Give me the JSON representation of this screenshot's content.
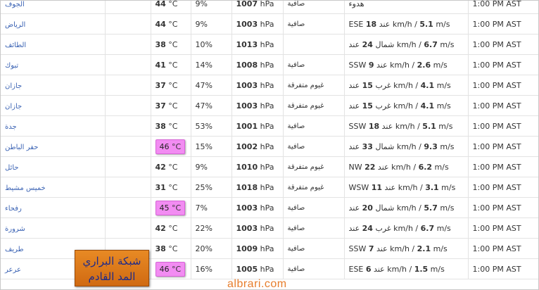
{
  "rows": [
    {
      "city": "الجوف",
      "temp": "44",
      "humidity": "9%",
      "pressure": "1007",
      "condition": "صافية",
      "wind_dir": "",
      "wind_kmh": "",
      "wind_ms": "",
      "wind_text": "هدوء",
      "time": "1:00 PM AST",
      "hot": false
    },
    {
      "city": "الرياض",
      "temp": "44",
      "humidity": "9%",
      "pressure": "1003",
      "condition": "صافية",
      "wind_dir": "ESE",
      "wind_kmh": "18",
      "wind_ms": "5.1",
      "wind_text": "",
      "time": "1:00 PM AST",
      "hot": false
    },
    {
      "city": "الطائف",
      "temp": "38",
      "humidity": "10%",
      "pressure": "1013",
      "condition": "",
      "wind_dir": "شمال",
      "wind_kmh": "24",
      "wind_ms": "6.7",
      "wind_text": "",
      "time": "1:00 PM AST",
      "hot": false
    },
    {
      "city": "تبوك",
      "temp": "41",
      "humidity": "14%",
      "pressure": "1008",
      "condition": "صافية",
      "wind_dir": "SSW",
      "wind_kmh": "9",
      "wind_ms": "2.6",
      "wind_text": "",
      "time": "1:00 PM AST",
      "hot": false
    },
    {
      "city": "جازان",
      "temp": "37",
      "humidity": "47%",
      "pressure": "1003",
      "condition": "غيوم متفرقة",
      "wind_dir": "غرب",
      "wind_kmh": "15",
      "wind_ms": "4.1",
      "wind_text": "",
      "time": "1:00 PM AST",
      "hot": false
    },
    {
      "city": "جازان",
      "temp": "37",
      "humidity": "47%",
      "pressure": "1003",
      "condition": "غيوم متفرقة",
      "wind_dir": "غرب",
      "wind_kmh": "15",
      "wind_ms": "4.1",
      "wind_text": "",
      "time": "1:00 PM AST",
      "hot": false
    },
    {
      "city": "جدة",
      "temp": "38",
      "humidity": "53%",
      "pressure": "1001",
      "condition": "صافية",
      "wind_dir": "SSW",
      "wind_kmh": "18",
      "wind_ms": "5.1",
      "wind_text": "",
      "time": "1:00 PM AST",
      "hot": false
    },
    {
      "city": "حفر الباطن",
      "temp": "46",
      "humidity": "15%",
      "pressure": "1002",
      "condition": "صافية",
      "wind_dir": "شمال",
      "wind_kmh": "33",
      "wind_ms": "9.3",
      "wind_text": "",
      "time": "1:00 PM AST",
      "hot": true
    },
    {
      "city": "حائل",
      "temp": "42",
      "humidity": "9%",
      "pressure": "1010",
      "condition": "غيوم متفرقة",
      "wind_dir": "NW",
      "wind_kmh": "22",
      "wind_ms": "6.2",
      "wind_text": "",
      "time": "1:00 PM AST",
      "hot": false
    },
    {
      "city": "خميس مشيط",
      "temp": "31",
      "humidity": "25%",
      "pressure": "1018",
      "condition": "غيوم متفرقة",
      "wind_dir": "WSW",
      "wind_kmh": "11",
      "wind_ms": "3.1",
      "wind_text": "",
      "time": "1:00 PM AST",
      "hot": false
    },
    {
      "city": "رفحاء",
      "temp": "45",
      "humidity": "7%",
      "pressure": "1003",
      "condition": "صافية",
      "wind_dir": "شمال",
      "wind_kmh": "20",
      "wind_ms": "5.7",
      "wind_text": "",
      "time": "1:00 PM AST",
      "hot": true
    },
    {
      "city": "شرورة",
      "temp": "42",
      "humidity": "22%",
      "pressure": "1003",
      "condition": "صافية",
      "wind_dir": "غرب",
      "wind_kmh": "24",
      "wind_ms": "6.7",
      "wind_text": "",
      "time": "1:00 PM AST",
      "hot": false
    },
    {
      "city": "طريف",
      "temp": "38",
      "humidity": "20%",
      "pressure": "1009",
      "condition": "صافية",
      "wind_dir": "SSW",
      "wind_kmh": "7",
      "wind_ms": "2.1",
      "wind_text": "",
      "time": "1:00 PM AST",
      "hot": false
    },
    {
      "city": "عرعر",
      "temp": "46",
      "humidity": "16%",
      "pressure": "1005",
      "condition": "صافية",
      "wind_dir": "ESE",
      "wind_kmh": "6",
      "wind_ms": "1.5",
      "wind_text": "",
      "time": "1:00 PM AST",
      "hot": true
    }
  ],
  "units": {
    "temp": "°C",
    "pressure": "hPa",
    "wind_kmh": "km/h",
    "wind_ms": "m/s",
    "wind_prefix": "عند",
    "wind_sep": "/"
  },
  "logo": {
    "line1": "شبكة البراري",
    "line2": "المد القادم"
  },
  "watermark": "albrari.com",
  "colors": {
    "hot_highlight": "#f28cf2",
    "link": "#3b63b4",
    "logo_bg": "#e07a1c",
    "watermark": "#e77d2b"
  }
}
